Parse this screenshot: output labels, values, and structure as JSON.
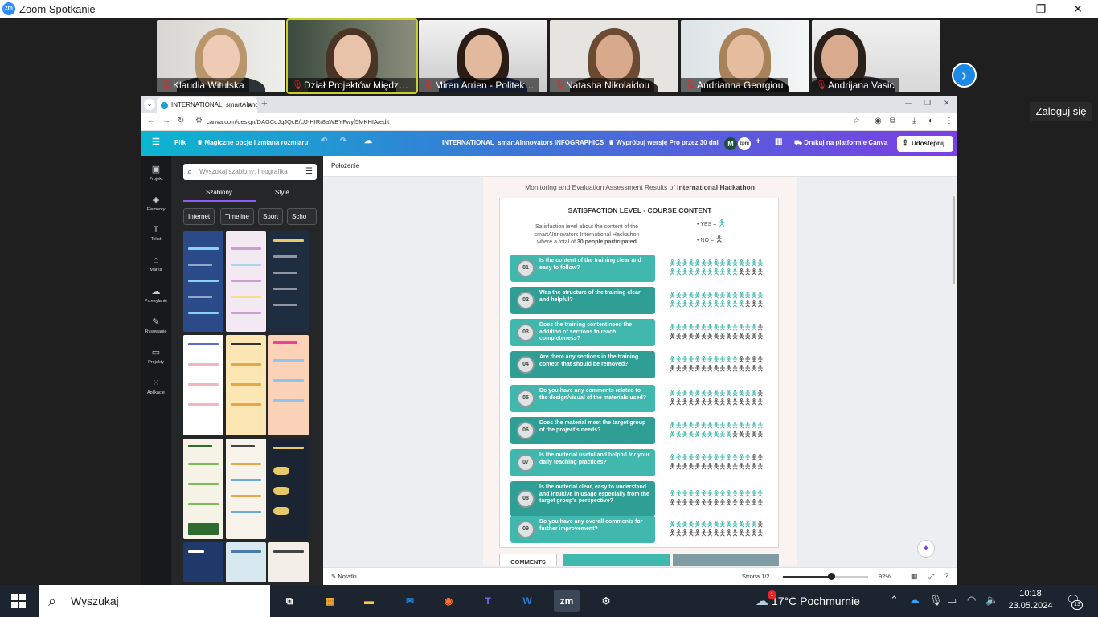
{
  "window": {
    "title": "Zoom Spotkanie",
    "logo": "zm",
    "minimize": "—",
    "maximize": "❐",
    "close": "✕"
  },
  "participants": [
    {
      "name": "Klaudia Witulska"
    },
    {
      "name": "Dział Projektów Międzyn…"
    },
    {
      "name": "Miren Arrien - Politek…"
    },
    {
      "name": "Natasha Nikolaidou"
    },
    {
      "name": "Andrianna Georgiou"
    },
    {
      "name": "Andrijana Vasic"
    }
  ],
  "zoom_signin": "Zaloguj się",
  "browser": {
    "tab_title": "INTERNATIONAL_smartAInnova",
    "url": "canva.com/design/DAGCqJqJQcE/UJ-HIRr8aWBYFwyf5MKHIA/edit"
  },
  "canva_bar": {
    "file": "Plik",
    "magic": "Magiczne opcje i zmiana rozmiaru",
    "doc_title": "INTERNATIONAL_smartAInnovators INFOGRAPHICS",
    "try_pro": "Wypróbuj wersję Pro przez 30 dni",
    "avatar_m": "M",
    "avatar_zpm": "zpm",
    "print": "Drukuj na platformie Canva",
    "share": "Udostępnij"
  },
  "left_nav": [
    {
      "label": "Projekt",
      "icon": "▣"
    },
    {
      "label": "Elementy",
      "icon": "◈"
    },
    {
      "label": "Tekst",
      "icon": "T"
    },
    {
      "label": "Marka",
      "icon": "⌂"
    },
    {
      "label": "Przesyłanie",
      "icon": "☁"
    },
    {
      "label": "Rysowanie",
      "icon": "✎"
    },
    {
      "label": "Projekty",
      "icon": "▭"
    },
    {
      "label": "Aplikacje",
      "icon": "⁙"
    }
  ],
  "panel": {
    "search_placeholder": "Wyszukaj szablony: Infografika",
    "tab_templates": "Szablony",
    "tab_styles": "Style",
    "chips": [
      "Internet",
      "Timeline",
      "Sport",
      "Scho"
    ]
  },
  "workspace": {
    "position_label": "Położenie"
  },
  "infographic": {
    "header_pre": "Monitoring and Evaluation Assessment Results of ",
    "header_bold": "International Hackathon",
    "card_title": "SATISFACTION LEVEL - COURSE CONTENT",
    "desc_line1": "Satisfaction level about the content of the",
    "desc_line2": "smartAInnovators International Hackathon",
    "desc_line3_pre": "where a total of ",
    "desc_line3_bold": "30 people participated",
    "legend_yes": "YES =",
    "legend_no": "NO =",
    "questions": [
      {
        "num": "01",
        "text": "Is the content of the training clear and easy to follow?",
        "yes": 26,
        "no": 4
      },
      {
        "num": "02",
        "text": "Was the structure of the training clear and helpful?",
        "yes": 27,
        "no": 3
      },
      {
        "num": "03",
        "text": "Does the training content need the addition of sections to reach completeness?",
        "yes": 14,
        "no": 16
      },
      {
        "num": "04",
        "text": "Are there any sections in the training contetn that should be removed?",
        "yes": 11,
        "no": 19
      },
      {
        "num": "05",
        "text": "Do you have any comments related to the design/visual of the materials used?",
        "yes": 14,
        "no": 16
      },
      {
        "num": "06",
        "text": "Does the material meet the target group of the project's needs?",
        "yes": 25,
        "no": 5
      },
      {
        "num": "07",
        "text": "Is the material useful and helpful for your daily teaching practices?",
        "yes": 13,
        "no": 17
      },
      {
        "num": "08",
        "text": "Is the material clear, easy to understand and intuitive in usage especially from the target group's perspective?",
        "yes": 15,
        "no": 15
      },
      {
        "num": "09",
        "text": "Do you have any overall comments for further improvement?",
        "yes": 14,
        "no": 16
      }
    ],
    "comments_label": "COMMENTS",
    "colors": {
      "teal": "#40b8ad",
      "teal_dark": "#2f9e95",
      "grey": "#555555"
    }
  },
  "status_bar": {
    "notes": "Notatki",
    "page": "Strona 1/2",
    "zoom": "92%"
  },
  "taskbar": {
    "search": "Wyszukaj",
    "weather": "17°C  Pochmurnie",
    "weather_badge": "1",
    "time": "10:18",
    "date": "23.05.2024",
    "notifications": "13",
    "apps": [
      "task-view",
      "microsoft-store",
      "file-explorer",
      "outlook",
      "firefox",
      "teams",
      "word",
      "zoom",
      "settings"
    ]
  }
}
